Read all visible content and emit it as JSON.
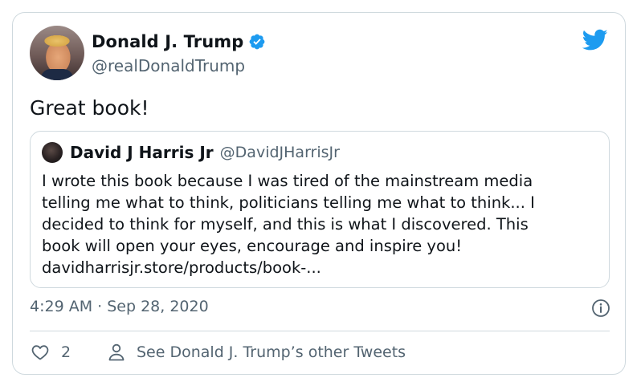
{
  "author": {
    "name": "Donald J. Trump",
    "handle": "@realDonaldTrump",
    "verified_icon": "verified-badge-icon",
    "avatar_icon": "avatar"
  },
  "tweet": {
    "text": "Great book!",
    "timestamp": "4:29 AM · Sep 28, 2020"
  },
  "quoted": {
    "name": "David J Harris Jr",
    "handle": "@DavidJHarrisJr",
    "lines": [
      "I wrote this book because I was tired of the mainstream media",
      "telling me what to think, politicians telling me what to think... I",
      "decided to think for myself, and this is what I discovered. This",
      "book will open your eyes, encourage and inspire you!",
      "davidharrisjr.store/products/book-..."
    ]
  },
  "actions": {
    "like_count": "2",
    "other_tweets_label": "See Donald J. Trump’s other Tweets"
  },
  "colors": {
    "accent": "#1d9bf0",
    "secondary_text": "#536471",
    "border": "#cfd9de"
  }
}
